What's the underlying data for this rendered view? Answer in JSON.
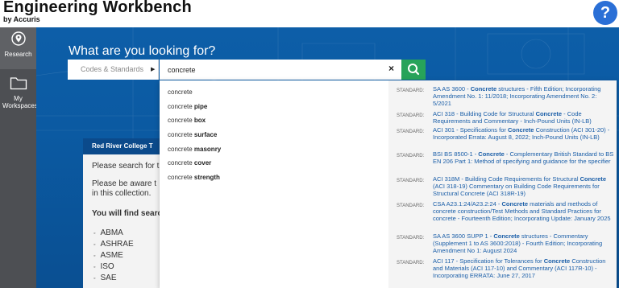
{
  "header": {
    "title": "Engineering Workbench",
    "subtitle": "by Accuris",
    "help_label": "?"
  },
  "sidebar": {
    "items": [
      {
        "label": "Research",
        "icon": "location-pin-icon"
      },
      {
        "label": "My Workspaces",
        "icon": "folder-icon"
      }
    ]
  },
  "hero": {
    "title": "What are you looking for?"
  },
  "search": {
    "scope_label": "Codes & Standards",
    "value": "concrete",
    "clear_label": "×"
  },
  "collection_panel": {
    "heading": "Red River College T",
    "line1": "Please search for t",
    "line2a": "Please be aware t",
    "line2b": "in this collection.",
    "find_label": "You will find searc",
    "orgs": [
      "ABMA",
      "ASHRAE",
      "ASME",
      "ISO",
      "SAE"
    ]
  },
  "suggestions": [
    {
      "base": "concrete",
      "bold": ""
    },
    {
      "base": "concrete ",
      "bold": "pipe"
    },
    {
      "base": "concrete ",
      "bold": "box"
    },
    {
      "base": "concrete ",
      "bold": "surface"
    },
    {
      "base": "concrete ",
      "bold": "masonry"
    },
    {
      "base": "concrete ",
      "bold": "cover"
    },
    {
      "base": "concrete ",
      "bold": "strength"
    }
  ],
  "standards": [
    {
      "label": "STANDARD:",
      "pre": "SA AS 3600 - ",
      "kw": "Concrete",
      "post": " structures - Fifth Edition; Incorporating Amendment No. 1: 11/2018; Incorporating Amendment No. 2: 5/2021"
    },
    {
      "label": "STANDARD:",
      "pre": "ACI 318 - Building Code for Structural ",
      "kw": "Concrete",
      "post": " - Code Requirements and Commentary - Inch-Pound Units (IN-LB)"
    },
    {
      "label": "STANDARD:",
      "pre": "ACI 301 - Specifications for ",
      "kw": "Concrete",
      "post": " Construction (ACI 301-20) - Incorporated Errata: August 8, 2022; Inch-Pound Units (IN-LB)"
    },
    {
      "label": "STANDARD:",
      "pre": "BSI BS 8500-1 - ",
      "kw": "Concrete",
      "post": " - Complementary British Standard to BS EN 206 Part 1: Method of specifying and guidance for the specifier"
    },
    {
      "label": "STANDARD:",
      "pre": "ACI 318M - Building Code Requirements for Structural ",
      "kw": "Concrete",
      "post": " (ACI 318-19) Commentary on Building Code Requirements for Structural Concrete (ACI 318R-19)"
    },
    {
      "label": "STANDARD:",
      "pre": "CSA A23.1:24/A23.2:24 - ",
      "kw": "Concrete",
      "post": " materials and methods of concrete construction/Test Methods and Standard Practices for concrete - Fourteenth Edition; Incorporating Update: January 2025"
    },
    {
      "label": "STANDARD:",
      "pre": "SA AS 3600 SUPP 1 - ",
      "kw": "Concrete",
      "post": " structures - Commentary (Supplement 1 to AS 3600:2018) - Fourth Edition; Incorporating Amendment No 1: August 2024"
    },
    {
      "label": "STANDARD:",
      "pre": "ACI 117 - Specification for Tolerances for ",
      "kw": "Concrete",
      "post": " Construction and Materials (ACI 117-10) and Commentary (ACI 117R-10) - Incorporating ERRATA: June 27, 2017"
    }
  ],
  "colors": {
    "brand_blue": "#0d5ea8",
    "help_blue": "#2a6fd6",
    "search_green": "#27a35a",
    "link_blue": "#1a5ea8",
    "sidebar_gray": "#4d4f53"
  }
}
